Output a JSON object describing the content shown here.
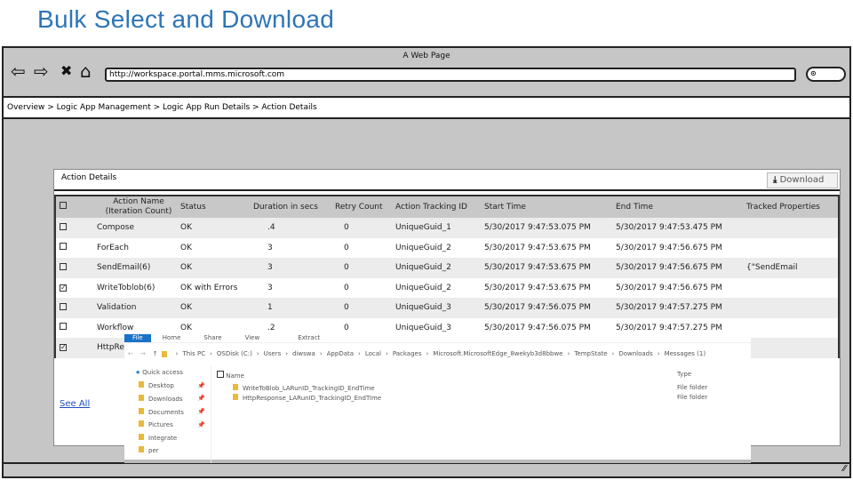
{
  "slide_title": "Bulk Select and Download",
  "browser": {
    "page_title": "A Web Page",
    "url": "http://workspace.portal.mms.microsoft.com",
    "back_icon": "⇦",
    "forward_icon": "⇨",
    "stop_icon": "✖",
    "home_icon": "⌂",
    "search_icon": "🔍"
  },
  "breadcrumb": "Overview > Logic App Management > Logic App Run Details > Action Details",
  "panel": {
    "title": "Action Details",
    "download_label": "Download",
    "see_all": "See All",
    "headers": [
      "Action Name (Iteration Count)",
      "Status",
      "Duration in secs",
      "Retry Count",
      "Action Tracking ID",
      "Start Time",
      "End Time",
      "Tracked Properties"
    ],
    "rows": [
      {
        "checked": false,
        "name": "Compose",
        "status": "OK",
        "duration": ".4",
        "retry": "0",
        "tracking": "UniqueGuid_1",
        "start": "5/30/2017 9:47:53.075 PM",
        "end": "5/30/2017 9:47:53.475 PM",
        "props": ""
      },
      {
        "checked": false,
        "name": "ForEach",
        "status": "OK",
        "duration": "3",
        "retry": "0",
        "tracking": "UniqueGuid_2",
        "start": "5/30/2017 9:47:53.675 PM",
        "end": "5/30/2017 9:47:56.675 PM",
        "props": ""
      },
      {
        "checked": false,
        "name": "SendEmail(6)",
        "status": "OK",
        "duration": "3",
        "retry": "0",
        "tracking": "UniqueGuid_2",
        "start": "5/30/2017 9:47:53.675 PM",
        "end": "5/30/2017 9:47:56.675 PM",
        "props": "{\"SendEmail"
      },
      {
        "checked": true,
        "name": "WriteToblob(6)",
        "status": "OK with Errors",
        "duration": "3",
        "retry": "0",
        "tracking": "UniqueGuid_2",
        "start": "5/30/2017 9:47:53.675 PM",
        "end": "5/30/2017 9:47:56.675 PM",
        "props": ""
      },
      {
        "checked": false,
        "name": "Validation",
        "status": "OK",
        "duration": "1",
        "retry": "0",
        "tracking": "UniqueGuid_3",
        "start": "5/30/2017 9:47:56.075 PM",
        "end": "5/30/2017 9:47:57.275 PM",
        "props": ""
      },
      {
        "checked": false,
        "name": "Workflow",
        "status": "OK",
        "duration": ".2",
        "retry": "0",
        "tracking": "UniqueGuid_3",
        "start": "5/30/2017 9:47:56.075 PM",
        "end": "5/30/2017 9:47:57.275 PM",
        "props": ""
      },
      {
        "checked": true,
        "name": "HttpRes",
        "status": "",
        "duration": "",
        "retry": "",
        "tracking": "",
        "start": "",
        "end": "",
        "props": ""
      }
    ]
  },
  "explorer": {
    "tabs": [
      "File",
      "Home",
      "Share",
      "View",
      "Extract"
    ],
    "path": [
      "This PC",
      "OSDisk (C:)",
      "Users",
      "diwswa",
      "AppData",
      "Local",
      "Packages",
      "Microsoft.MicrosoftEdge_8wekyb3d8bbwe",
      "TempState",
      "Downloads",
      "Messages (1)"
    ],
    "quick_access": "Quick access",
    "nav": [
      "Desktop",
      "Downloads",
      "Documents",
      "Pictures",
      "Integrate",
      "per"
    ],
    "col_name": "Name",
    "col_type": "Type",
    "files": [
      {
        "name": "WriteToBlob_LARunID_TrackingID_EndTime",
        "type": "File folder"
      },
      {
        "name": "HttpResponse_LARunID_TrackingID_EndTime",
        "type": "File folder"
      }
    ]
  }
}
